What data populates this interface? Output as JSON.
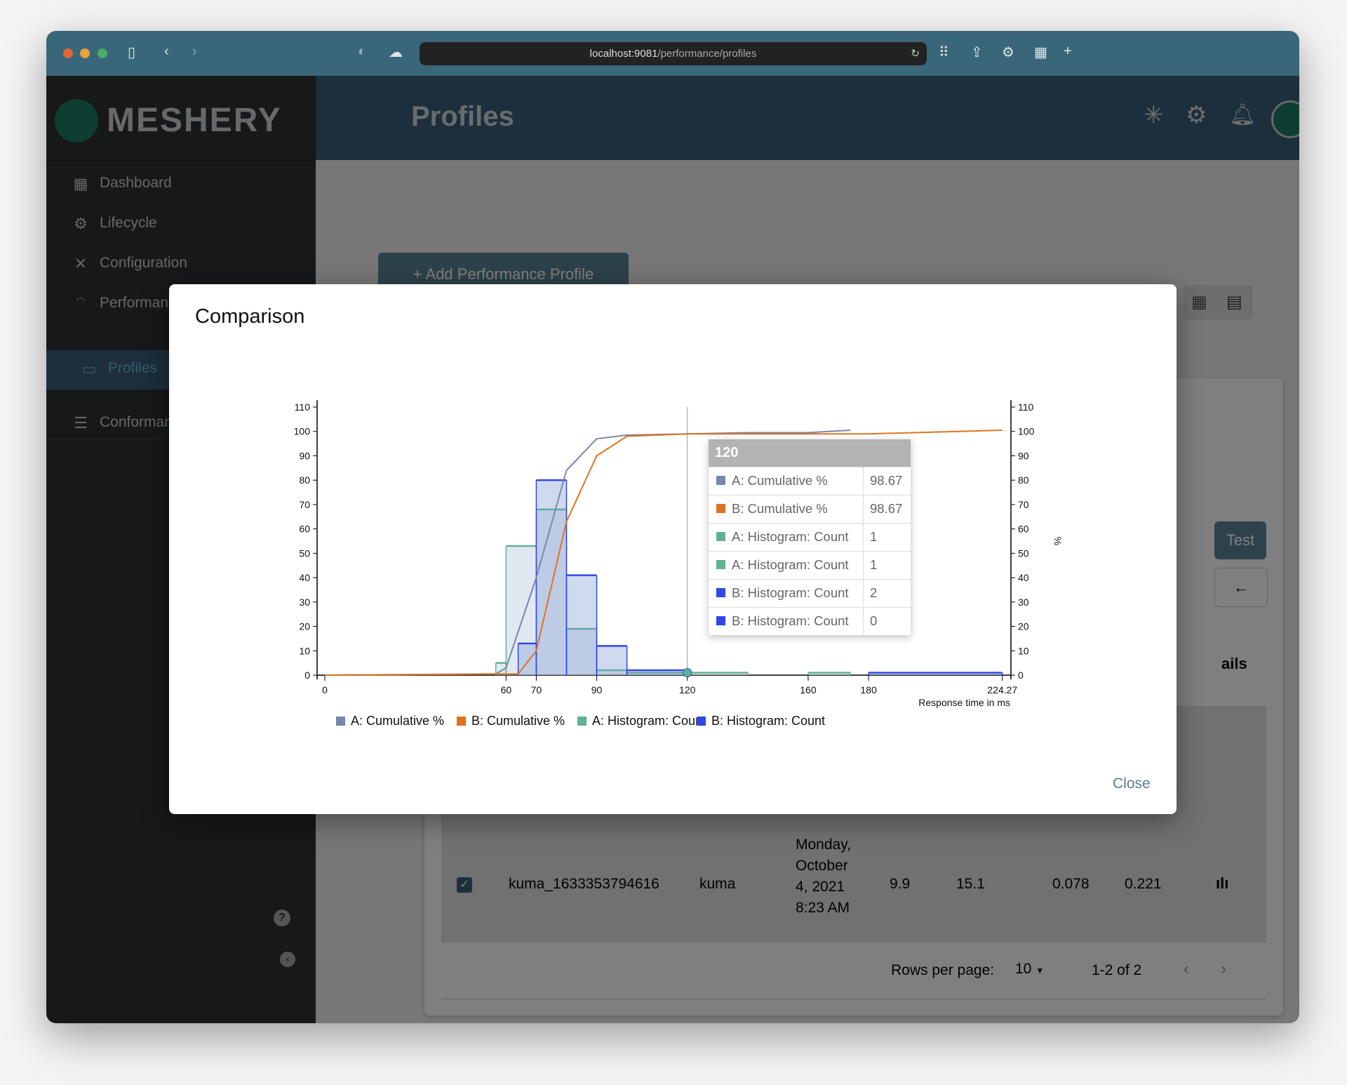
{
  "browser": {
    "url_host": "localhost:9081",
    "url_path": "/performance/profiles"
  },
  "app": {
    "logo_text": "MESHERY",
    "page_title": "Profiles"
  },
  "sidebar": {
    "items": [
      {
        "label": "Dashboard",
        "icon": "dashboard-icon"
      },
      {
        "label": "Lifecycle",
        "icon": "gears-icon"
      },
      {
        "label": "Configuration",
        "icon": "tools-icon"
      },
      {
        "label": "Performance",
        "icon": "smp-gauge-icon"
      },
      {
        "label": "Profiles",
        "icon": "profiles-icon",
        "active": true
      },
      {
        "label": "Conformance",
        "icon": "checklist-icon"
      }
    ]
  },
  "content": {
    "add_button": "+ Add Performance Profile",
    "test_button": "Test",
    "details_label": "ails",
    "table_row": {
      "name": "kuma_1633353794616",
      "mesh": "kuma",
      "date_lines": [
        "Monday,",
        "October",
        "4, 2021",
        "8:23 AM"
      ],
      "v1": "9.9",
      "v2": "15.1",
      "v3": "0.078",
      "v4": "0.221",
      "checked": true
    },
    "pagination": {
      "rows_label": "Rows per page:",
      "rows_value": "10",
      "range": "1-2 of 2"
    }
  },
  "modal": {
    "title": "Comparison",
    "close_label": "Close",
    "tooltip": {
      "header": "120",
      "rows": [
        {
          "name": "A: Cumulative %",
          "value": "98.67",
          "color": "#7986a8"
        },
        {
          "name": "B: Cumulative %",
          "value": "98.67",
          "color": "#e0731f"
        },
        {
          "name": "A: Histogram: Count",
          "value": "1",
          "color": "#5fb393"
        },
        {
          "name": "A: Histogram: Count",
          "value": "1",
          "color": "#5fb393"
        },
        {
          "name": "B: Histogram: Count",
          "value": "2",
          "color": "#3048e8"
        },
        {
          "name": "B: Histogram: Count",
          "value": "0",
          "color": "#3048e8"
        }
      ]
    }
  },
  "chart_data": {
    "type": "bar+line",
    "xlabel": "Response time in ms",
    "ylabel_right": "%",
    "xlim": [
      0,
      224.27
    ],
    "ylim": [
      0,
      110
    ],
    "x_ticks": [
      "0",
      "60",
      "70",
      "90",
      "120",
      "160",
      "180",
      "224.27"
    ],
    "y_ticks": [
      "0",
      "10",
      "20",
      "30",
      "40",
      "50",
      "60",
      "70",
      "80",
      "90",
      "100",
      "110"
    ],
    "legend_position": "bottom",
    "hover_x": 120,
    "series": [
      {
        "name": "A: Cumulative %",
        "kind": "line",
        "color": "#7986a8",
        "points": [
          [
            0,
            0
          ],
          [
            56.6,
            0.5
          ],
          [
            60,
            3
          ],
          [
            70,
            40
          ],
          [
            80,
            84
          ],
          [
            90,
            97
          ],
          [
            100,
            98.5
          ],
          [
            140,
            99.5
          ],
          [
            160,
            99.5
          ],
          [
            174,
            100.5
          ]
        ]
      },
      {
        "name": "B: Cumulative %",
        "kind": "line",
        "color": "#e0731f",
        "points": [
          [
            0,
            0
          ],
          [
            64,
            0.5
          ],
          [
            70,
            10
          ],
          [
            80,
            63
          ],
          [
            90,
            90
          ],
          [
            100,
            98
          ],
          [
            120,
            99
          ],
          [
            180,
            99
          ],
          [
            224.27,
            100.5
          ]
        ]
      },
      {
        "name": "A: Histogram: Count",
        "kind": "histogram",
        "color": "#5fb393",
        "bins": [
          [
            56.6,
            60,
            5
          ],
          [
            60,
            70,
            53
          ],
          [
            70,
            80,
            68
          ],
          [
            80,
            90,
            19
          ],
          [
            90,
            100,
            2
          ],
          [
            100,
            140,
            1
          ],
          [
            160,
            174,
            1
          ]
        ]
      },
      {
        "name": "B: Histogram: Count",
        "kind": "histogram",
        "color": "#3048e8",
        "bins": [
          [
            64,
            70,
            13
          ],
          [
            70,
            80,
            80
          ],
          [
            80,
            90,
            41
          ],
          [
            90,
            100,
            12
          ],
          [
            100,
            120,
            2
          ],
          [
            180,
            224.27,
            1
          ]
        ]
      }
    ]
  }
}
